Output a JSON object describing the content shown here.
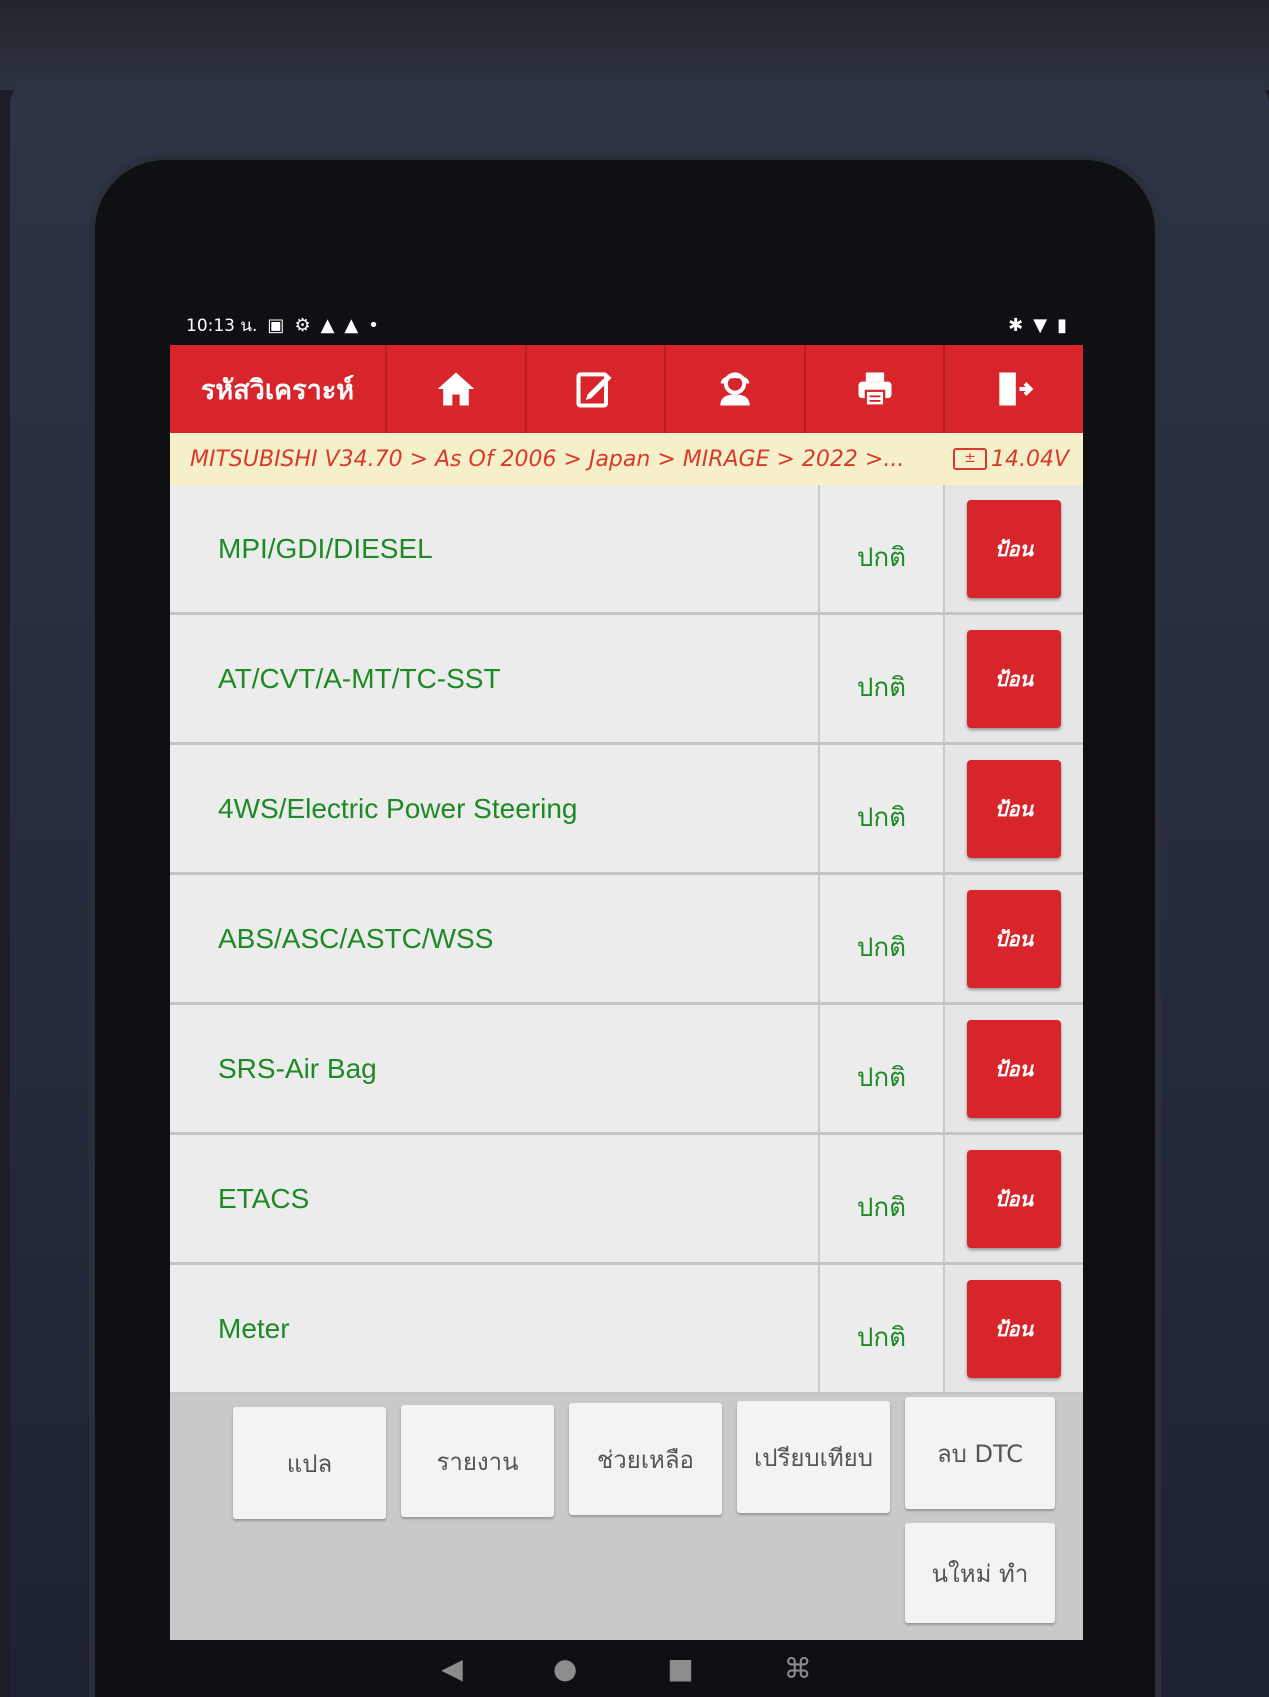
{
  "status_bar": {
    "time": "10:13 น.",
    "left_icons": [
      "calendar-icon",
      "settings-circle-icon",
      "warning-icon",
      "warning-icon",
      "dot-icon"
    ],
    "right_icons": [
      "bluetooth-icon",
      "wifi-icon",
      "battery-icon"
    ]
  },
  "toolbar": {
    "title": "รหัสวิเคราะห์",
    "tools": [
      "home-icon",
      "edit-icon",
      "support-agent-icon",
      "print-icon",
      "exit-icon"
    ]
  },
  "breadcrumb": {
    "path": "MITSUBISHI V34.70 > As Of 2006 > Japan > MIRAGE > 2022 >...",
    "voltage": "14.04V"
  },
  "systems": [
    {
      "name": "MPI/GDI/DIESEL",
      "status": "ปกติ",
      "action": "ป้อน"
    },
    {
      "name": "AT/CVT/A-MT/TC-SST",
      "status": "ปกติ",
      "action": "ป้อน"
    },
    {
      "name": "4WS/Electric Power Steering",
      "status": "ปกติ",
      "action": "ป้อน"
    },
    {
      "name": "ABS/ASC/ASTC/WSS",
      "status": "ปกติ",
      "action": "ป้อน"
    },
    {
      "name": "SRS-Air Bag",
      "status": "ปกติ",
      "action": "ป้อน"
    },
    {
      "name": "ETACS",
      "status": "ปกติ",
      "action": "ป้อน"
    },
    {
      "name": "Meter",
      "status": "ปกติ",
      "action": "ป้อน"
    }
  ],
  "function_buttons": {
    "translate": "แปล",
    "report": "รายงาน",
    "help": "ช่วยเหลือ",
    "compare": "เปรียบเทียบ",
    "clear_dtc": "ลบ DTC",
    "rescan": "นใหม่   ทำ"
  },
  "colors": {
    "brand_red": "#d8252b",
    "system_text_green": "#1e8a25",
    "breadcrumb_bg": "#f5f0c9"
  }
}
